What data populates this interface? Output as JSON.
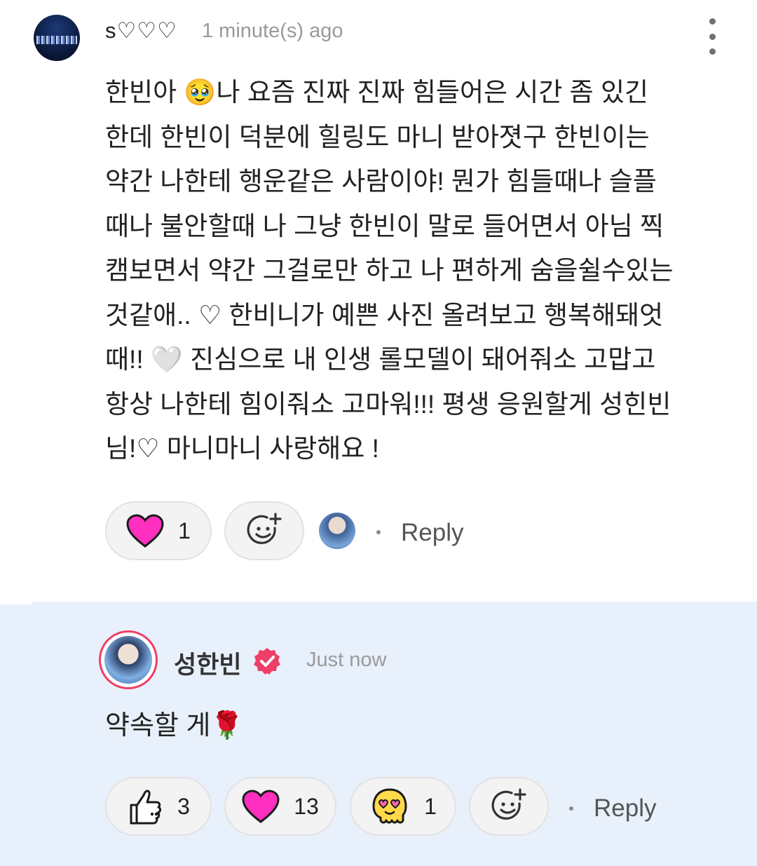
{
  "comment": {
    "username": "s♡♡♡",
    "timestamp": "1 minute(s) ago",
    "body_lines": [
      "한빈아 🥹나 요즘 진짜 진짜 힘들어은 시간 좀 있긴",
      "한데 한빈이 덕분에 힐링도 마니 받아졋구 한빈이는",
      "약간 나한테 행운같은 사람이야! 뭔가 힘들때나 슬플",
      "때나 불안할때 나 그냥 한빈이 말로 들어면서 아님 찍",
      "캠보면서 약간 그걸로만 하고 나 편하게 숨을쉴수있는",
      "것같애.. ♡ 한비니가 예쁜 사진 올려보고 행복해돼엇",
      "때!! 🤍 진심으로 내 인생 롤모델이 돼어줘소 고맙고",
      "항상 나한테 힘이줘소 고마워!!! 평생 응원할게 성힌빈",
      "님!♡ 마니마니 사랑해요 !"
    ],
    "reactions": [
      {
        "icon": "heart-icon",
        "count": "1"
      },
      {
        "icon": "add-reaction-icon",
        "count": ""
      }
    ],
    "reply_label": "Reply"
  },
  "reply": {
    "username": "성한빈",
    "timestamp": "Just now",
    "body": "약속할 게🌹",
    "reactions": [
      {
        "icon": "thumbs-up-icon",
        "count": "3"
      },
      {
        "icon": "heart-icon",
        "count": "13"
      },
      {
        "icon": "heart-eyes-face-icon",
        "count": "1"
      },
      {
        "icon": "add-reaction-icon",
        "count": ""
      }
    ],
    "reply_label": "Reply"
  },
  "colors": {
    "heart": "#ff2fbf",
    "verified": "#ee3f68",
    "reply_bg": "#e8f0fb",
    "reaction_face": "#ffd94a"
  }
}
